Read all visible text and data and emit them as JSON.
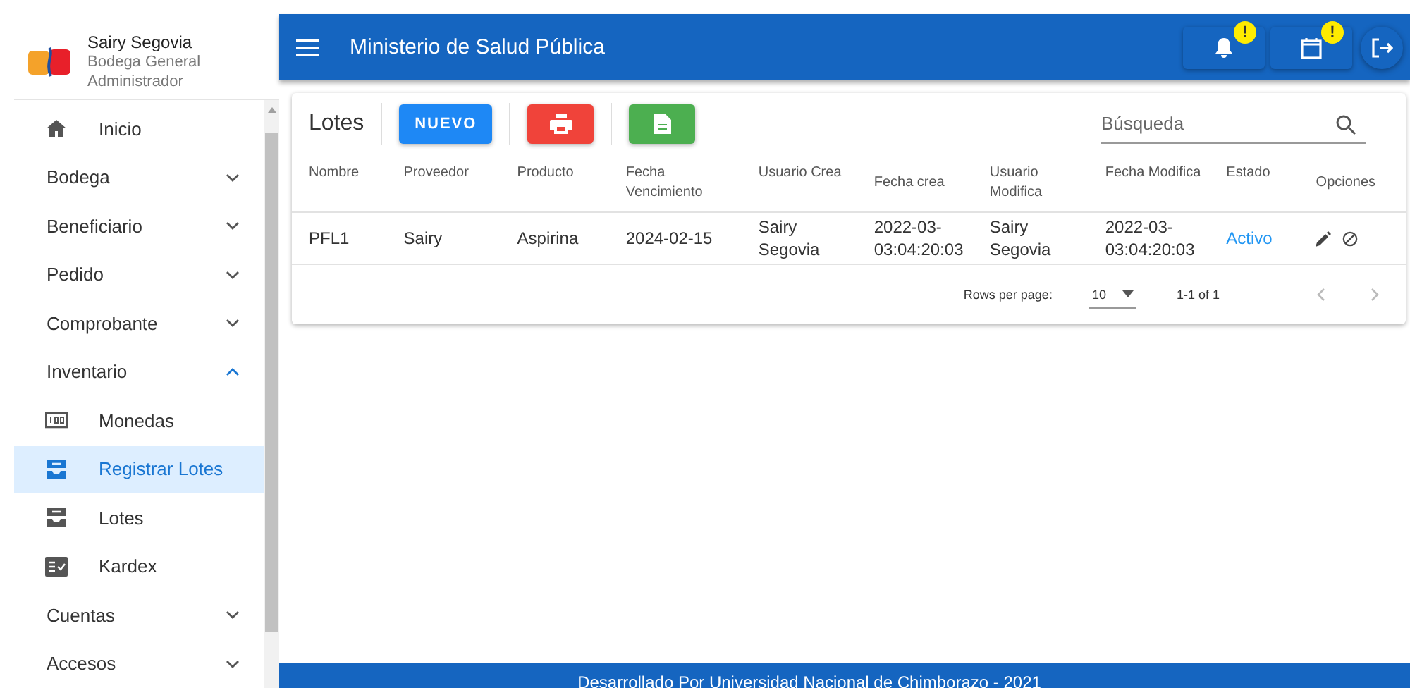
{
  "user": {
    "name": "Sairy Segovia",
    "place": "Bodega General",
    "role": "Administrador"
  },
  "menu": [
    {
      "kind": "home",
      "label": "Inicio",
      "selected": false
    },
    {
      "kind": "group",
      "label": "Bodega",
      "expanded": false
    },
    {
      "kind": "group",
      "label": "Beneficiario",
      "expanded": false
    },
    {
      "kind": "group",
      "label": "Pedido",
      "expanded": false
    },
    {
      "kind": "group",
      "label": "Comprobante",
      "expanded": false
    },
    {
      "kind": "group",
      "label": "Inventario",
      "expanded": true
    },
    {
      "kind": "coins",
      "label": "Monedas",
      "selected": false
    },
    {
      "kind": "tray",
      "label": "Registrar Lotes",
      "selected": true
    },
    {
      "kind": "tray",
      "label": "Lotes",
      "selected": false
    },
    {
      "kind": "checklist",
      "label": "Kardex",
      "selected": false
    },
    {
      "kind": "group",
      "label": "Cuentas",
      "expanded": false
    },
    {
      "kind": "group",
      "label": "Accesos",
      "expanded": false
    }
  ],
  "app_bar": {
    "title": "Ministerio de Salud Pública",
    "badges": [
      "!",
      "!"
    ]
  },
  "card": {
    "title": "Lotes",
    "new_button": "NUEVO",
    "search": {
      "placeholder": "Búsqueda"
    }
  },
  "table": {
    "columns": [
      "Nombre",
      "Proveedor",
      "Producto",
      "Fecha Vencimiento",
      "Usuario Crea",
      "Fecha crea",
      "Usuario Modifica",
      "Fecha Modifica",
      "Estado",
      "Opciones"
    ],
    "rows": [
      {
        "cells": [
          "PFL1",
          "Sairy",
          "Aspirina",
          "2024-02-15",
          "Sairy Segovia",
          "2022-03-03:04:20:03",
          "Sairy Segovia",
          "2022-03-03:04:20:03"
        ],
        "status": "Activo",
        "active": true
      }
    ]
  },
  "pagination": {
    "rows_label": "Rows per page:",
    "rows_value": "10",
    "range": "1-1 of 1"
  },
  "footer": "Desarrollado Por Universidad Nacional de Chimborazo - 2021"
}
